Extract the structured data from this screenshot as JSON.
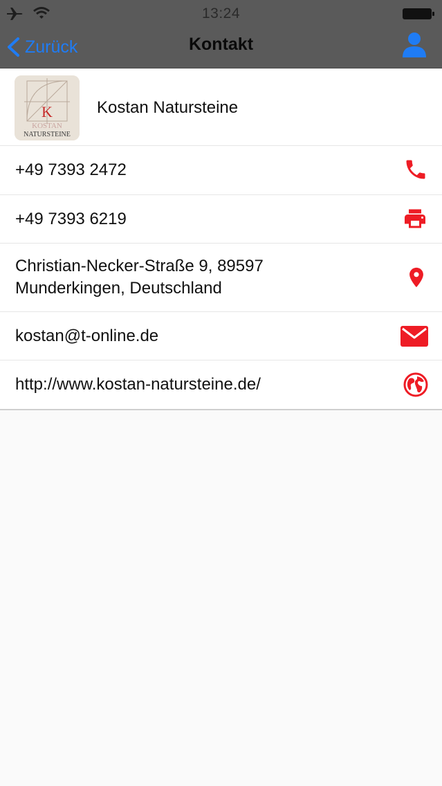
{
  "status_bar": {
    "time": "13:24"
  },
  "nav": {
    "back_label": "Zurück",
    "title": "Kontakt"
  },
  "company": {
    "name": "Kostan Natursteine",
    "logo_letter": "K",
    "logo_line1": "KOSTAN",
    "logo_line2": "NATURSTEINE"
  },
  "contacts": {
    "phone": "+49 7393 2472",
    "fax": "+49 7393 6219",
    "address_line1": "Christian-Necker-Straße 9, 89597",
    "address_line2": "Munderkingen, Deutschland",
    "email": "kostan@t-online.de",
    "website": "http://www.kostan-natursteine.de/"
  },
  "colors": {
    "accent_red": "#ee1c25",
    "link_blue": "#1f7cf5",
    "bar_gray": "#5a5a5a"
  },
  "icons": [
    "airplane-icon",
    "wifi-icon",
    "battery-icon",
    "back-chevron-icon",
    "person-icon",
    "phone-icon",
    "printer-icon",
    "location-pin-icon",
    "mail-icon",
    "globe-icon"
  ]
}
